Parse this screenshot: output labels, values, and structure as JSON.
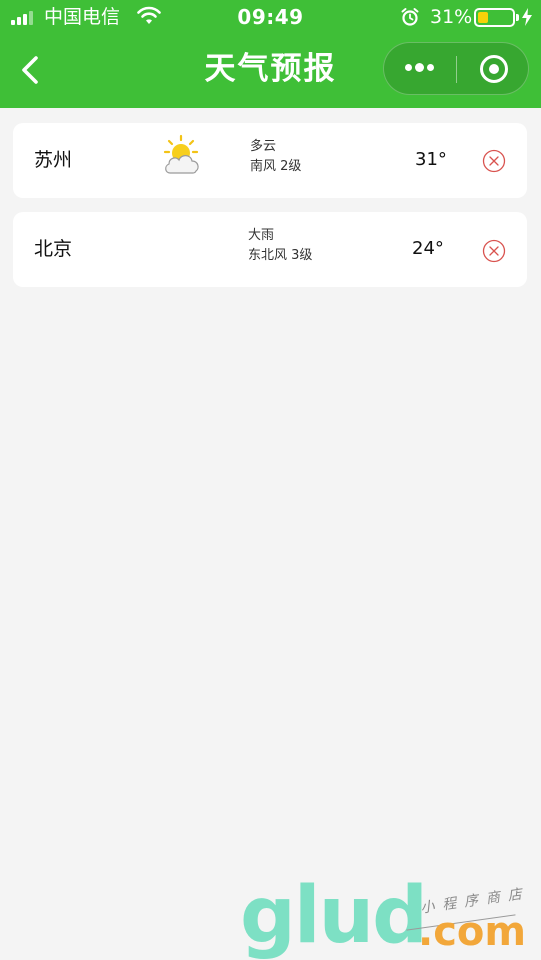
{
  "status_bar": {
    "carrier": "中国电信",
    "time": "09:49",
    "battery_percent": "31%",
    "battery_level": 0.31,
    "icons": [
      "signal-icon",
      "wifi-icon",
      "alarm-icon",
      "battery-icon",
      "charging-icon"
    ]
  },
  "nav": {
    "title": "天气预报",
    "back_icon": "chevron-left-icon",
    "menu_icon": "more-dots-icon",
    "close_icon": "target-circle-icon"
  },
  "cities": [
    {
      "name": "苏州",
      "condition": "多云",
      "wind": "南风 2级",
      "temp": "31°",
      "icon": "partly-cloudy-icon",
      "remove_icon": "close-circle-icon"
    },
    {
      "name": "北京",
      "condition": "大雨",
      "wind": "东北风 3级",
      "temp": "24°",
      "icon": "",
      "remove_icon": "close-circle-icon"
    }
  ],
  "watermark": {
    "brand": "glud",
    "domain": ".com",
    "tagline": "小程序商店"
  },
  "colors": {
    "header_green": "#3fbf37",
    "background": "#f4f4f4",
    "remove_red": "#d9534f",
    "battery_yellow": "#f5d20a"
  }
}
